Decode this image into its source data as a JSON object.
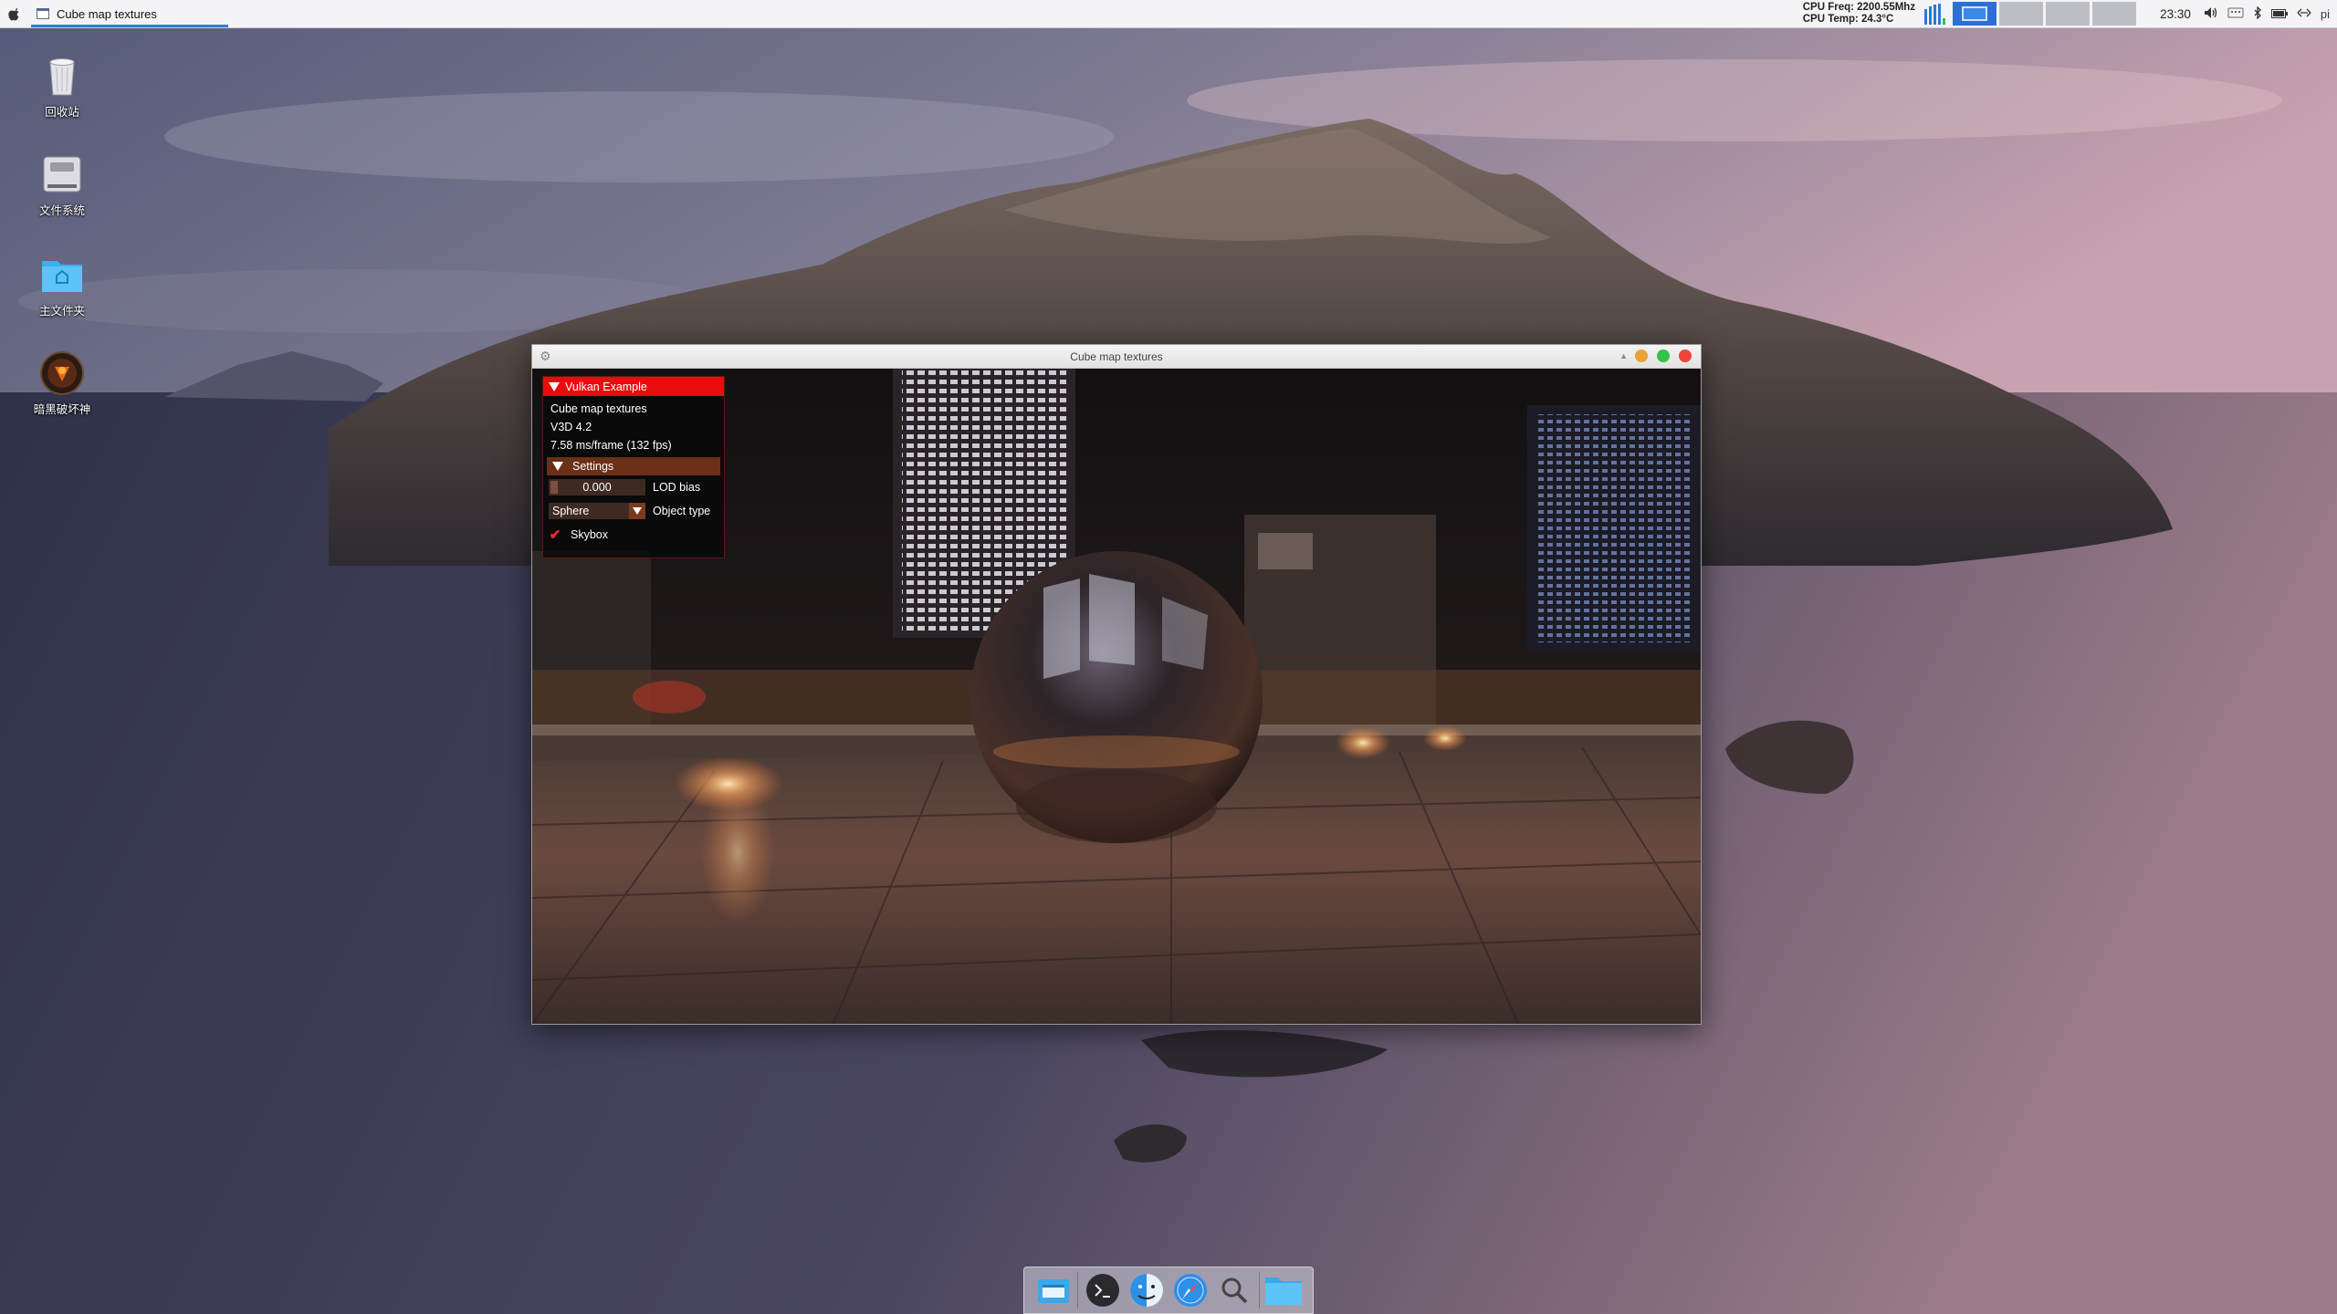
{
  "taskbar": {
    "active_task_title": "Cube map textures",
    "cpu_freq": "CPU Freq: 2200.55Mhz",
    "cpu_temp": "CPU Temp: 24.3°C",
    "clock": "23:30",
    "user": "pi",
    "cpu_graph_levels": [
      0.7,
      0.85,
      0.9,
      0.95,
      0.3
    ],
    "accent_color": "#2f7fd8"
  },
  "desktop_icons": [
    {
      "label": "回收站",
      "icon": "trash-icon"
    },
    {
      "label": "文件系统",
      "icon": "drive-icon"
    },
    {
      "label": "主文件夹",
      "icon": "home-folder-icon"
    },
    {
      "label": "暗黑破坏神",
      "icon": "diablo-game-icon"
    }
  ],
  "window": {
    "title": "Cube map textures",
    "buttons": [
      "minimize",
      "maximize",
      "close"
    ],
    "button_colors": {
      "minimize": "#e8a23a",
      "maximize": "#35c24a",
      "close": "#f0443a"
    }
  },
  "overlay": {
    "header": "Vulkan Example",
    "app_name": "Cube map textures",
    "device": "V3D 4.2",
    "frame_stats": "7.58 ms/frame (132 fps)",
    "settings_header": "Settings",
    "lod_bias": {
      "value": "0.000",
      "label": "LOD bias"
    },
    "object_type": {
      "value": "Sphere",
      "label": "Object type"
    },
    "skybox": {
      "label": "Skybox",
      "checked": true
    },
    "header_color": "#e80c0c"
  },
  "dock": {
    "items": [
      "file-manager-icon",
      "terminal-icon",
      "finder-icon",
      "browser-icon",
      "search-icon",
      "folder-icon"
    ]
  }
}
